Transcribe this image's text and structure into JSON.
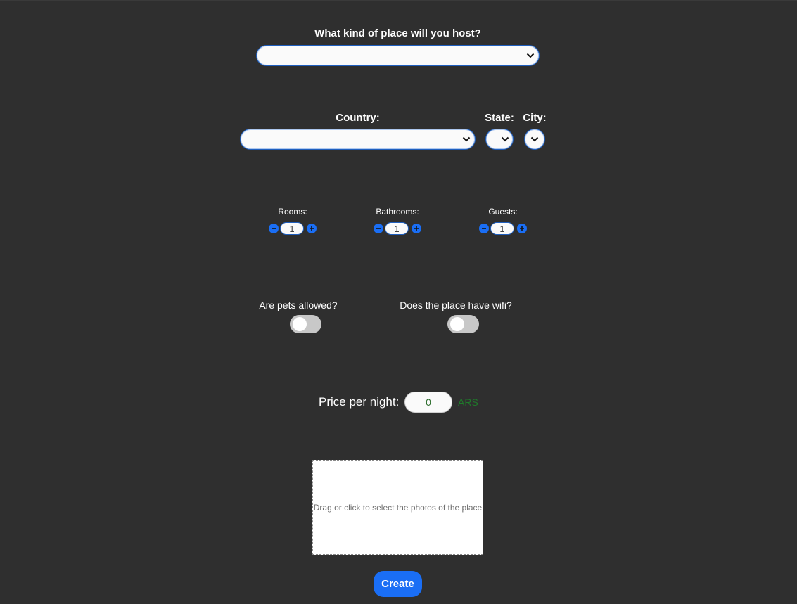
{
  "place_type": {
    "label": "What kind of place will you host?",
    "selected": ""
  },
  "location": {
    "country_label": "Country:",
    "country_selected": "",
    "state_label": "State:",
    "state_selected": "",
    "city_label": "City:",
    "city_selected": ""
  },
  "counters": {
    "rooms": {
      "label": "Rooms:",
      "value": "1"
    },
    "bathrooms": {
      "label": "Bathrooms:",
      "value": "1"
    },
    "guests": {
      "label": "Guests:",
      "value": "1"
    }
  },
  "toggles": {
    "pets": {
      "label": "Are pets allowed?",
      "on": false
    },
    "wifi": {
      "label": "Does the place have wifi?",
      "on": false
    }
  },
  "price": {
    "label": "Price per night:",
    "value": "0",
    "currency": "ARS"
  },
  "photos": {
    "dropzone_text": "Drag or click to select the photos of the place"
  },
  "actions": {
    "create_label": "Create"
  },
  "colors": {
    "background": "#2f2f2f",
    "accent": "#1a6ef5",
    "currency": "#1f7a2a"
  }
}
